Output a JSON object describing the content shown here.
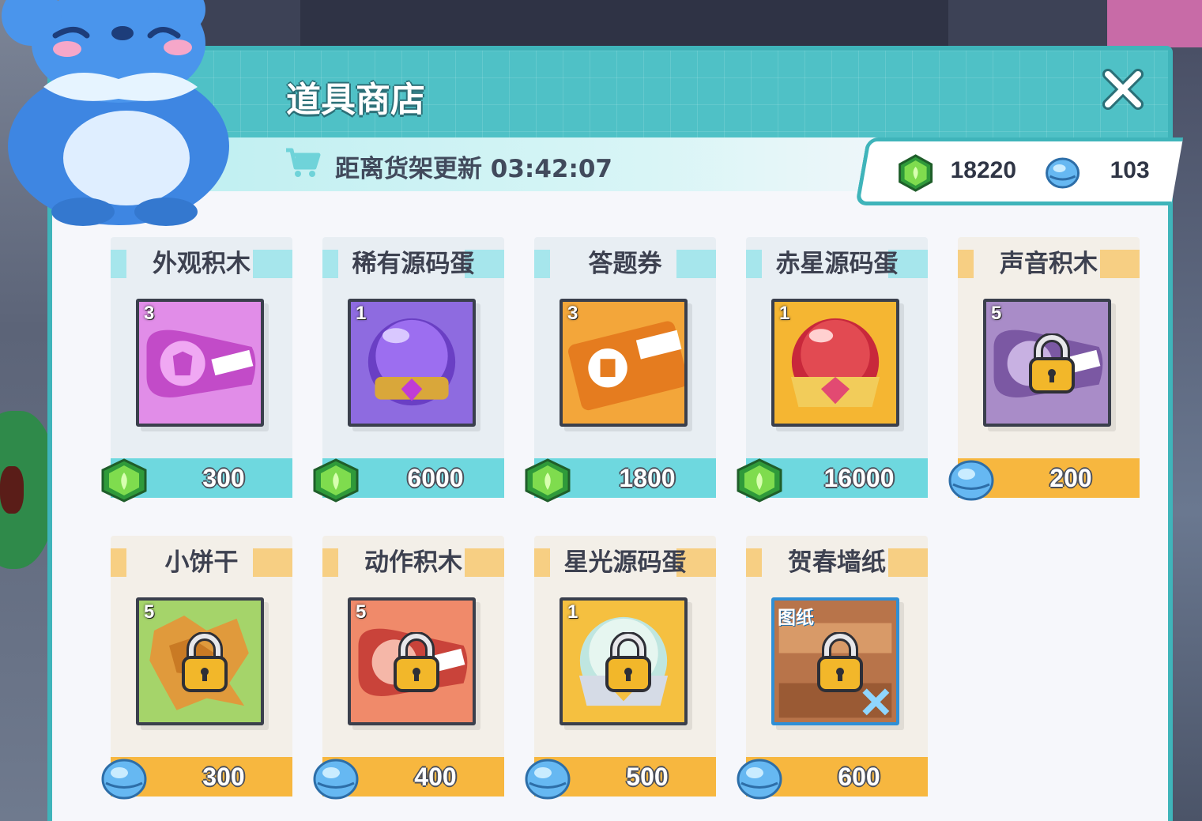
{
  "shop": {
    "title": "道具商店",
    "refresh_label": "距离货架更新 03:42:07"
  },
  "wallet": {
    "gems": "18220",
    "bells": "103"
  },
  "items": [
    {
      "name": "外观积木",
      "qty": "3",
      "price": "300",
      "currency": "gem",
      "locked": false,
      "art": "looks"
    },
    {
      "name": "稀有源码蛋",
      "qty": "1",
      "price": "6000",
      "currency": "gem",
      "locked": false,
      "art": "purple-egg"
    },
    {
      "name": "答题券",
      "qty": "3",
      "price": "1800",
      "currency": "gem",
      "locked": false,
      "art": "ticket"
    },
    {
      "name": "赤星源码蛋",
      "qty": "1",
      "price": "16000",
      "currency": "gem",
      "locked": false,
      "art": "red-egg"
    },
    {
      "name": "声音积木",
      "qty": "5",
      "price": "200",
      "currency": "bell",
      "locked": true,
      "art": "sound"
    },
    {
      "name": "小饼干",
      "qty": "5",
      "price": "300",
      "currency": "bell",
      "locked": true,
      "art": "cookie"
    },
    {
      "name": "动作积木",
      "qty": "5",
      "price": "400",
      "currency": "bell",
      "locked": true,
      "art": "motion"
    },
    {
      "name": "星光源码蛋",
      "qty": "1",
      "price": "500",
      "currency": "bell",
      "locked": true,
      "art": "star-egg"
    },
    {
      "name": "贺春墙纸",
      "tag": "图纸",
      "price": "600",
      "currency": "bell",
      "locked": true,
      "art": "wallpaper"
    }
  ],
  "colors": {
    "teal": "#4fc1c6",
    "price_teal": "#6ed8df",
    "price_gold": "#f7b73f",
    "panel_bg": "#f6f7fb"
  }
}
